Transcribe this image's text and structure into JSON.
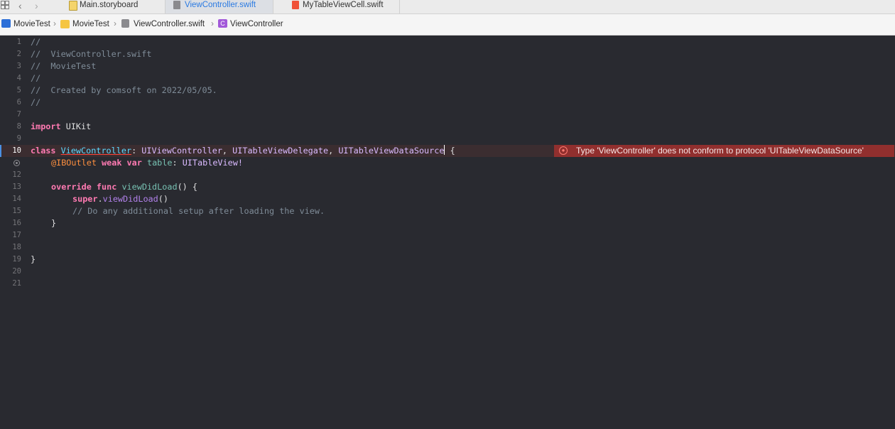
{
  "tabbar": {
    "tabs": [
      {
        "label": "Main.storyboard"
      },
      {
        "label": "ViewController.swift"
      },
      {
        "label": "MyTableViewCell.swift"
      }
    ]
  },
  "jumpbar": {
    "crumbs": [
      {
        "label": "MovieTest"
      },
      {
        "label": "MovieTest"
      },
      {
        "label": "ViewController.swift"
      },
      {
        "label": "ViewController"
      }
    ]
  },
  "editor": {
    "line_numbers": [
      "1",
      "2",
      "3",
      "4",
      "5",
      "6",
      "7",
      "8",
      "9",
      "10",
      "12",
      "13",
      "14",
      "15",
      "16",
      "17",
      "18",
      "19",
      "20",
      "21"
    ],
    "code": {
      "l1": "//",
      "l2": "//  ViewController.swift",
      "l3": "//  MovieTest",
      "l4": "//",
      "l5": "//  Created by comsoft on 2022/05/05.",
      "l6": "//",
      "l8_kw": "import",
      "l8_rest": " UIKit",
      "l10_kw": "class",
      "l10_name": "ViewController",
      "l10_colon": ": ",
      "l10_t1": "UIViewController",
      "l10_c1": ", ",
      "l10_t2": "UITableViewDelegate",
      "l10_c2": ", ",
      "l10_t3": "UITableViewDataSource",
      "l10_brace": " {",
      "l11_attr": "@IBOutlet",
      "l11_kw": "weak var",
      "l11_name": " table",
      "l11_colon": ": ",
      "l11_type": "UITableView!",
      "l13_kw": "override func",
      "l13_fn": " viewDidLoad",
      "l13_rest": "() {",
      "l14_kw": "super",
      "l14_dot": ".",
      "l14_fn": "viewDidLoad",
      "l14_rest": "()",
      "l15": "// Do any additional setup after loading the view.",
      "l16": "}",
      "l19": "}"
    },
    "error": {
      "message": "Type 'ViewController' does not conform to protocol 'UITableViewDataSource'",
      "icon": "error-circle-icon",
      "color": "#912f2e"
    }
  }
}
